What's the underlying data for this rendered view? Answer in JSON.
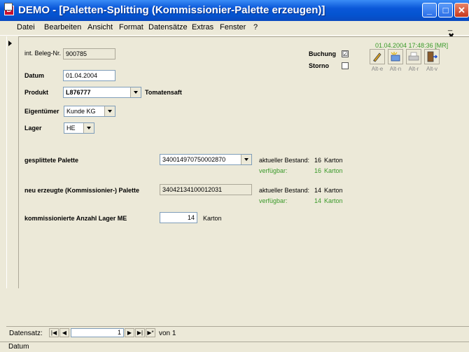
{
  "window": {
    "title": "DEMO - [Paletten-Splitting (Kommissionier-Palette erzeugen)]",
    "app_icon_letter": "D"
  },
  "menu": {
    "items": [
      "Datei",
      "Bearbeiten",
      "Ansicht",
      "Format",
      "Datensätze",
      "Extras",
      "Fenster",
      "?"
    ],
    "mdi_controls": "_ ✖ ✕"
  },
  "header": {
    "timestamp": "01.04.2004 17:48:36 [MR]",
    "toolbar": [
      {
        "icon": "pencil-icon",
        "caption": "Alt-e"
      },
      {
        "icon": "new-record-icon",
        "caption": "Alt-n"
      },
      {
        "icon": "print-icon",
        "caption": "Alt-r"
      },
      {
        "icon": "exit-door-icon",
        "caption": "Alt-v"
      }
    ]
  },
  "form": {
    "beleg_label": "int. Beleg-Nr.",
    "beleg_value": "900785",
    "datum_label": "Datum",
    "datum_value": "01.04.2004",
    "produkt_label": "Produkt",
    "produkt_value": "L876777",
    "produkt_name": "Tomatensaft",
    "eigentuemer_label": "Eigentümer",
    "eigentuemer_value": "Kunde KG",
    "lager_label": "Lager",
    "lager_value": "HE",
    "buchung_label": "Buchung",
    "buchung_checked": "☑",
    "storno_label": "Storno",
    "storno_checked": "",
    "gesplittete_label": "gesplittete Palette",
    "gesplittete_value": "340014970750002870",
    "gesplittete_bestand_label": "aktueller Bestand:",
    "gesplittete_bestand_value": "16",
    "gesplittete_bestand_unit": "Karton",
    "gesplittete_verfuegbar_label": "verfügbar:",
    "gesplittete_verfuegbar_value": "16",
    "gesplittete_verfuegbar_unit": "Karton",
    "neu_label": "neu erzeugte (Kommissionier-) Palette",
    "neu_value": "34042134100012031",
    "neu_bestand_label": "aktueller Bestand:",
    "neu_bestand_value": "14",
    "neu_bestand_unit": "Karton",
    "neu_verfuegbar_label": "verfügbar:",
    "neu_verfuegbar_value": "14",
    "neu_verfuegbar_unit": "Karton",
    "anzahl_label": "kommissionierte Anzahl Lager ME",
    "anzahl_value": "14",
    "anzahl_unit": "Karton"
  },
  "navigation": {
    "label": "Datensatz:",
    "current": "1",
    "of_label": "von 1"
  },
  "status": {
    "text": "Datum"
  },
  "colors": {
    "titlebar": "#0a57d8",
    "green_text": "#3a9a2a",
    "background": "#ece9d8"
  }
}
